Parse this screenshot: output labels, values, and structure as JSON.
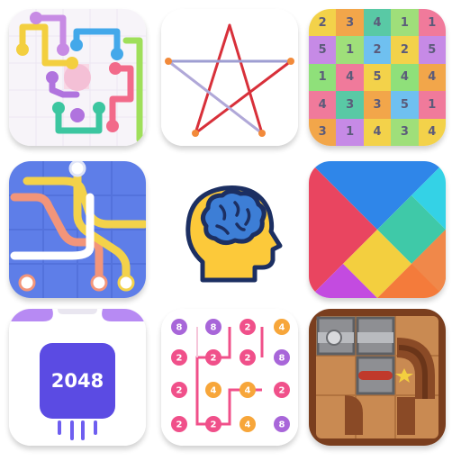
{
  "apps": [
    {
      "id": "flow",
      "name": "flow-lines-game-icon"
    },
    {
      "id": "star",
      "name": "one-line-star-game-icon"
    },
    {
      "id": "numgrid",
      "name": "number-grid-game-icon"
    },
    {
      "id": "pipes",
      "name": "pipe-connect-game-icon"
    },
    {
      "id": "brain",
      "name": "brain-head-icon"
    },
    {
      "id": "tangram",
      "name": "tangram-game-icon"
    },
    {
      "id": "2048",
      "name": "2048-game-icon"
    },
    {
      "id": "dots",
      "name": "number-dots-game-icon"
    },
    {
      "id": "unblock",
      "name": "unblock-ball-game-icon"
    }
  ],
  "numgrid": {
    "rows": [
      [
        {
          "v": "2",
          "c": "#f3d24a"
        },
        {
          "v": "3",
          "c": "#f2a64a"
        },
        {
          "v": "4",
          "c": "#59c9a5"
        },
        {
          "v": "1",
          "c": "#9fdf7a"
        },
        {
          "v": "1",
          "c": "#f07a9b"
        }
      ],
      [
        {
          "v": "5",
          "c": "#c68ae6"
        },
        {
          "v": "1",
          "c": "#9fdf7a"
        },
        {
          "v": "2",
          "c": "#6fc0f0"
        },
        {
          "v": "2",
          "c": "#f3d24a"
        },
        {
          "v": "5",
          "c": "#c68ae6"
        }
      ],
      [
        {
          "v": "1",
          "c": "#8fe07a"
        },
        {
          "v": "4",
          "c": "#f07a9b"
        },
        {
          "v": "5",
          "c": "#f3d24a"
        },
        {
          "v": "4",
          "c": "#8fe07a"
        },
        {
          "v": "4",
          "c": "#f2a64a"
        }
      ],
      [
        {
          "v": "4",
          "c": "#f07a9b"
        },
        {
          "v": "3",
          "c": "#59c9a5"
        },
        {
          "v": "3",
          "c": "#f2a64a"
        },
        {
          "v": "5",
          "c": "#6fc0f0"
        },
        {
          "v": "1",
          "c": "#f07a9b"
        }
      ],
      [
        {
          "v": "3",
          "c": "#f2a64a"
        },
        {
          "v": "1",
          "c": "#c68ae6"
        },
        {
          "v": "4",
          "c": "#f3d24a"
        },
        {
          "v": "3",
          "c": "#9fdf7a"
        },
        {
          "v": "4",
          "c": "#f3d24a"
        }
      ]
    ]
  },
  "game2048": {
    "label": "2048"
  },
  "dots": {
    "labels": [
      {
        "v": "8"
      },
      {
        "v": "8"
      },
      {
        "v": "2"
      },
      {
        "v": "4"
      },
      {
        "v": "2"
      },
      {
        "v": "2"
      },
      {
        "v": "2"
      },
      {
        "v": "8"
      },
      {
        "v": "2"
      },
      {
        "v": "4"
      },
      {
        "v": "4"
      },
      {
        "v": "2"
      },
      {
        "v": "2"
      },
      {
        "v": "2"
      },
      {
        "v": "4"
      },
      {
        "v": "8"
      }
    ]
  }
}
